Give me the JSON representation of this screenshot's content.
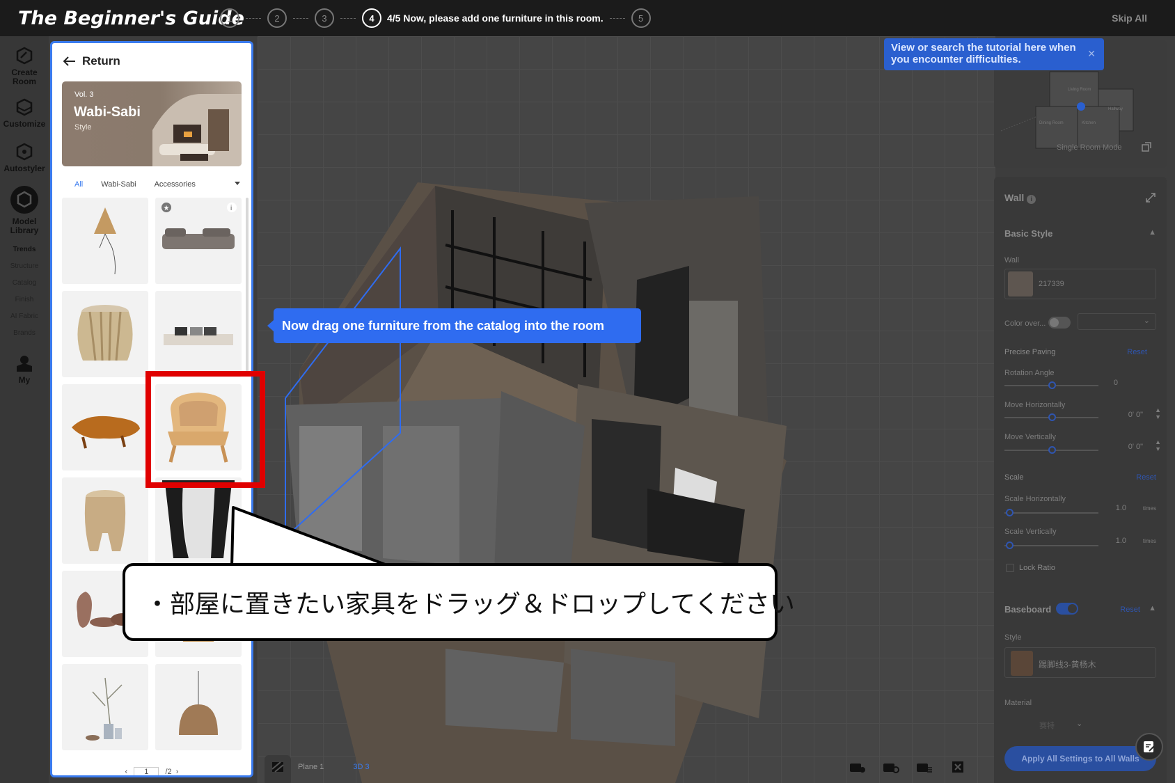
{
  "guide": {
    "title": "The Beginner's Guide",
    "steps": [
      "1",
      "2",
      "3",
      "4",
      "5"
    ],
    "active_step_text": "4/5 Now, please add one furniture in this room.",
    "skip_label": "Skip All"
  },
  "rail": {
    "create_room": "Create Room",
    "customize": "Customize",
    "autostyler": "Autostyler",
    "model_library": "Model Library",
    "trends": "Trends",
    "structure": "Structure",
    "catalog": "Catalog",
    "finish": "Finish",
    "ai_fabric": "AI Fabric",
    "brands": "Brands",
    "my": "My"
  },
  "catalog": {
    "return_label": "Return",
    "banner": {
      "vol": "Vol. 3",
      "name": "Wabi-Sabi",
      "style": "Style"
    },
    "tabs": [
      "All",
      "Wabi-Sabi",
      "Accessories"
    ],
    "active_tab": "All",
    "pager": {
      "current": "1",
      "total": "/2"
    }
  },
  "viewport": {
    "drag_tip": "Now drag one furniture from the catalog into the room",
    "bottom": {
      "plane_label": "Plane",
      "plane_value": "1",
      "view_label": "3D",
      "view_value": "3"
    }
  },
  "tutorial_tip": {
    "text": "View or search the tutorial here when you encounter difficulties.",
    "close": "✕"
  },
  "minimap": {
    "mode_label": "Single Room Mode",
    "rooms": [
      "Living Room",
      "Hallway",
      "Dining Room",
      "Kitchen"
    ]
  },
  "props": {
    "title": "Wall",
    "basic_style": "Basic Style",
    "wall_label": "Wall",
    "wall_code": "217339",
    "color_override": "Color over...",
    "precise_paving": "Precise Paving",
    "reset": "Reset",
    "rotation_angle": "Rotation Angle",
    "rotation_value": "0",
    "move_h": "Move Horizontally",
    "move_h_value": "0' 0\"",
    "move_v": "Move Vertically",
    "move_v_value": "0' 0\"",
    "scale": "Scale",
    "scale_h": "Scale Horizontally",
    "scale_h_value": "1.0",
    "scale_v": "Scale Vertically",
    "scale_v_value": "1.0",
    "times": "times",
    "lock_ratio": "Lock Ratio",
    "baseboard": "Baseboard",
    "style_label": "Style",
    "style_value": "踢脚线3-黄杨木",
    "material_label": "Material",
    "material_value": "赛特",
    "apply_all": "Apply All Settings to All Walls"
  },
  "callout": {
    "text": "・部屋に置きたい家具をドラッグ＆ドロップしてください"
  },
  "colors": {
    "accent_blue": "#2f6cf0",
    "highlight_red": "#e00000"
  }
}
